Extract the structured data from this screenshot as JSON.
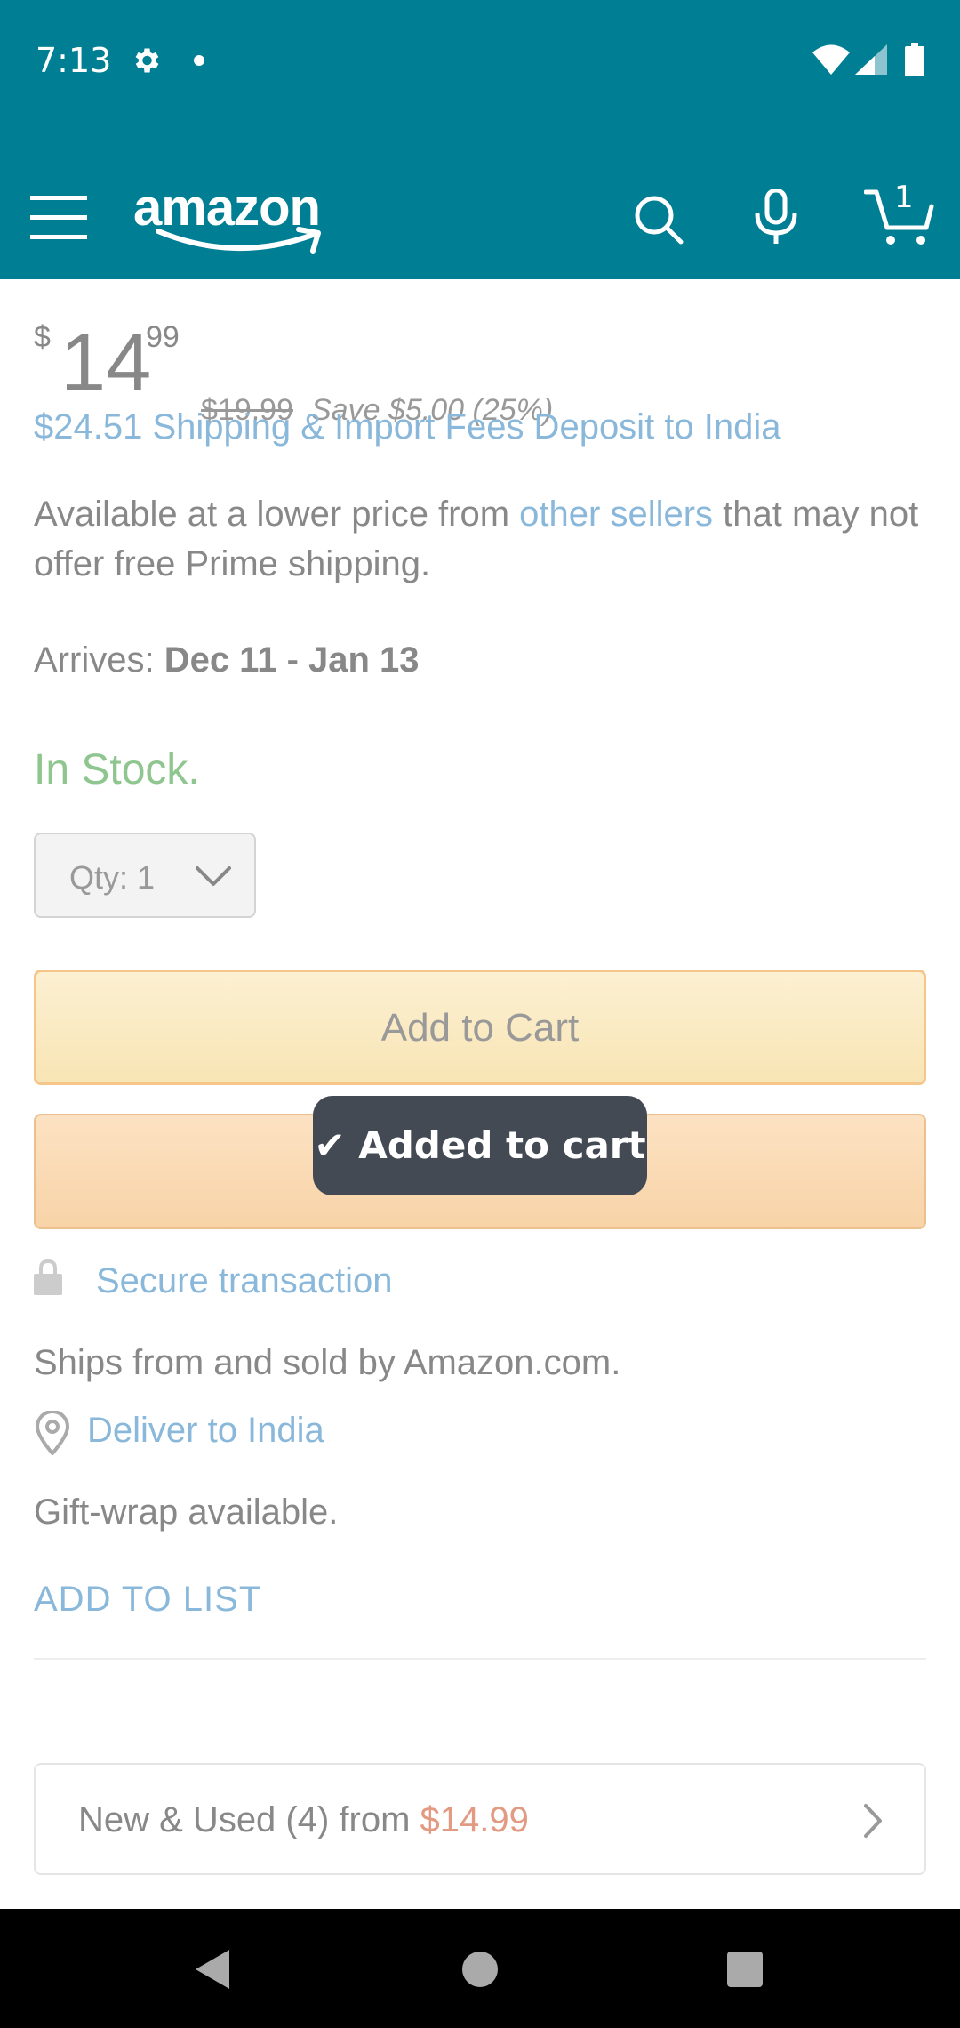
{
  "status_bar": {
    "time": "7:13"
  },
  "app_bar": {
    "logo_text": "amazon",
    "cart_count": "1"
  },
  "product": {
    "price_symbol": "$",
    "price_whole": "14",
    "price_fraction": "99",
    "list_price": "$19.99",
    "savings": "Save $5.00 (25%)",
    "shipping_text": "$24.51 Shipping & Import Fees Deposit to India",
    "availability_prefix": "Available at a lower price from ",
    "availability_link": "other sellers",
    "availability_suffix": " that may not offer free Prime shipping.",
    "arrives_label": "Arrives: ",
    "arrives_dates": "Dec 11 - Jan 13",
    "stock_status": "In Stock.",
    "qty_label": "Qty:  1"
  },
  "buttons": {
    "add_to_cart": "Add to Cart",
    "add_to_list": "ADD TO LIST"
  },
  "toast": {
    "message": "✔ Added to cart"
  },
  "details": {
    "secure_transaction": "Secure transaction",
    "ships_from": "Ships from and sold by Amazon.com.",
    "deliver_to": "Deliver to India",
    "gift_wrap": "Gift-wrap available."
  },
  "offers": {
    "label": "New & Used (4) from ",
    "price": "$14.99"
  },
  "colors": {
    "header_bg": "#007F94",
    "link": "#8AB8DA",
    "in_stock": "#8FC68F",
    "toast_bg": "#434A54"
  }
}
